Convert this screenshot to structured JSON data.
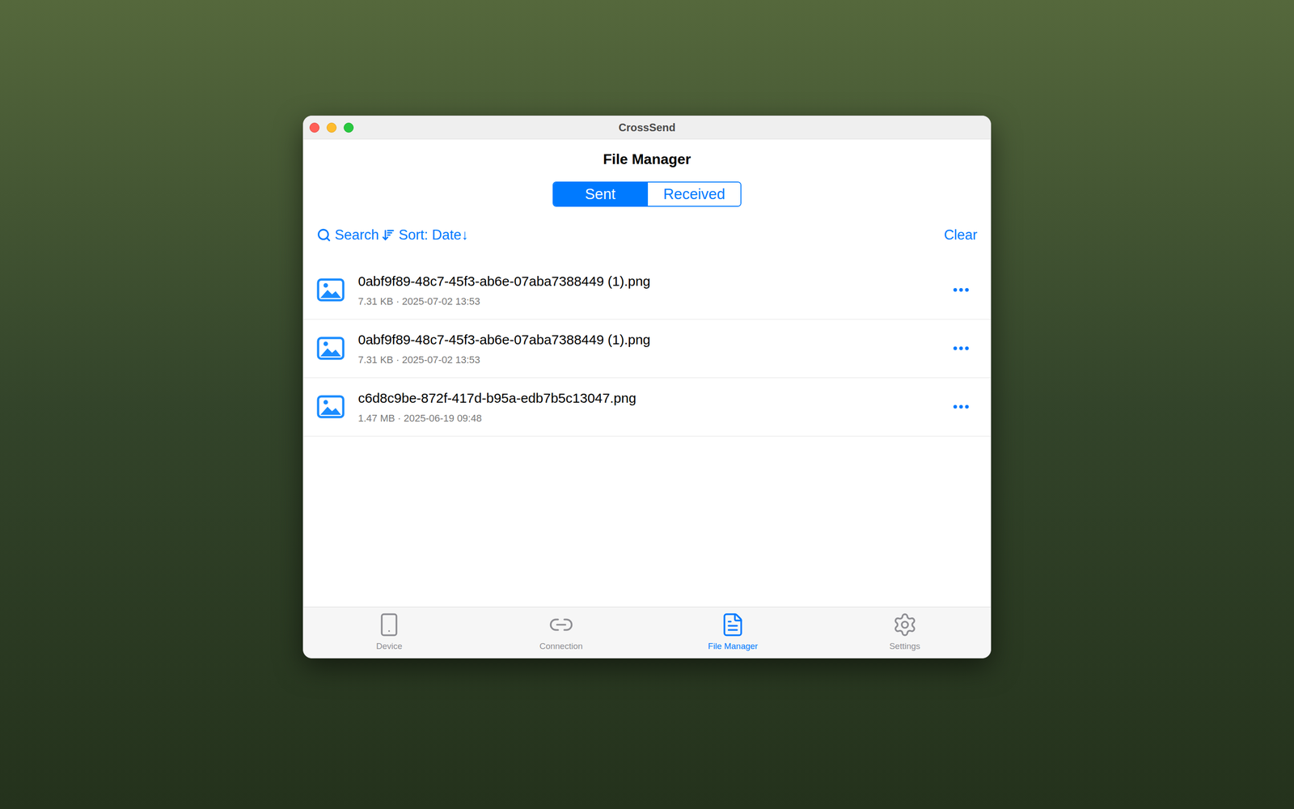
{
  "window": {
    "title": "CrossSend"
  },
  "header": {
    "title": "File Manager"
  },
  "segments": [
    {
      "label": "Sent",
      "selected": true
    },
    {
      "label": "Received",
      "selected": false
    }
  ],
  "toolbar": {
    "search": "Search",
    "sort": "Sort: Date↓",
    "clear": "Clear"
  },
  "files": [
    {
      "name": "0abf9f89-48c7-45f3-ab6e-07aba7388449 (1).png",
      "details": "7.31 KB · 2025-07-02 13:53"
    },
    {
      "name": "0abf9f89-48c7-45f3-ab6e-07aba7388449 (1).png",
      "details": "7.31 KB · 2025-07-02 13:53"
    },
    {
      "name": "c6d8c9be-872f-417d-b95a-edb7b5c13047.png",
      "details": "1.47 MB · 2025-06-19 09:48"
    }
  ],
  "tabbar": [
    {
      "label": "Device",
      "selected": false
    },
    {
      "label": "Connection",
      "selected": false
    },
    {
      "label": "File Manager",
      "selected": true
    },
    {
      "label": "Settings",
      "selected": false
    }
  ]
}
